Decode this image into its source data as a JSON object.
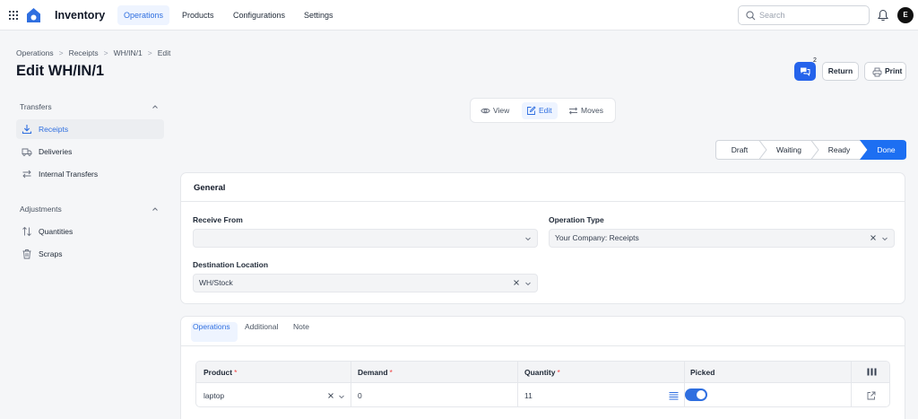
{
  "app": {
    "name": "Inventory"
  },
  "nav": {
    "items": [
      "Operations",
      "Products",
      "Configurations",
      "Settings"
    ]
  },
  "search": {
    "placeholder": "Search"
  },
  "user": {
    "avatar_initial": "E"
  },
  "breadcrumb": [
    "Operations",
    "Receipts",
    "WH/IN/1",
    "Edit"
  ],
  "page": {
    "title": "Edit WH/IN/1"
  },
  "actions": {
    "chat_count": "2",
    "return_label": "Return",
    "print_label": "Print"
  },
  "sidebar": {
    "transfers": {
      "title": "Transfers",
      "items": [
        {
          "label": "Receipts",
          "icon": "download-icon",
          "active": true
        },
        {
          "label": "Deliveries",
          "icon": "truck-icon"
        },
        {
          "label": "Internal Transfers",
          "icon": "transfer-arrows-icon"
        }
      ]
    },
    "adjustments": {
      "title": "Adjustments",
      "items": [
        {
          "label": "Quantities",
          "icon": "sort-arrows-icon"
        },
        {
          "label": "Scraps",
          "icon": "trash-icon"
        }
      ]
    }
  },
  "view_switch": {
    "view": "View",
    "edit": "Edit",
    "moves": "Moves",
    "active": "Edit"
  },
  "status": {
    "steps": [
      "Draft",
      "Waiting",
      "Ready",
      "Done"
    ],
    "current": "Done"
  },
  "general": {
    "title": "General",
    "receive_from": {
      "label": "Receive From",
      "value": ""
    },
    "operation_type": {
      "label": "Operation Type",
      "value": "Your Company: Receipts"
    },
    "destination_location": {
      "label": "Destination Location",
      "value": "WH/Stock"
    }
  },
  "tabs": {
    "operations": "Operations",
    "additional": "Additional",
    "note": "Note",
    "active": "Operations"
  },
  "table": {
    "headers": {
      "product": "Product",
      "demand": "Demand",
      "quantity": "Quantity",
      "picked": "Picked"
    },
    "required_mark": "*",
    "rows": [
      {
        "product": "laptop",
        "demand": "0",
        "quantity": "11",
        "picked": true
      }
    ]
  },
  "colors": {
    "accent": "#2f6fe0",
    "primary_button": "#2563eb",
    "done_step": "#1d6ff2"
  }
}
